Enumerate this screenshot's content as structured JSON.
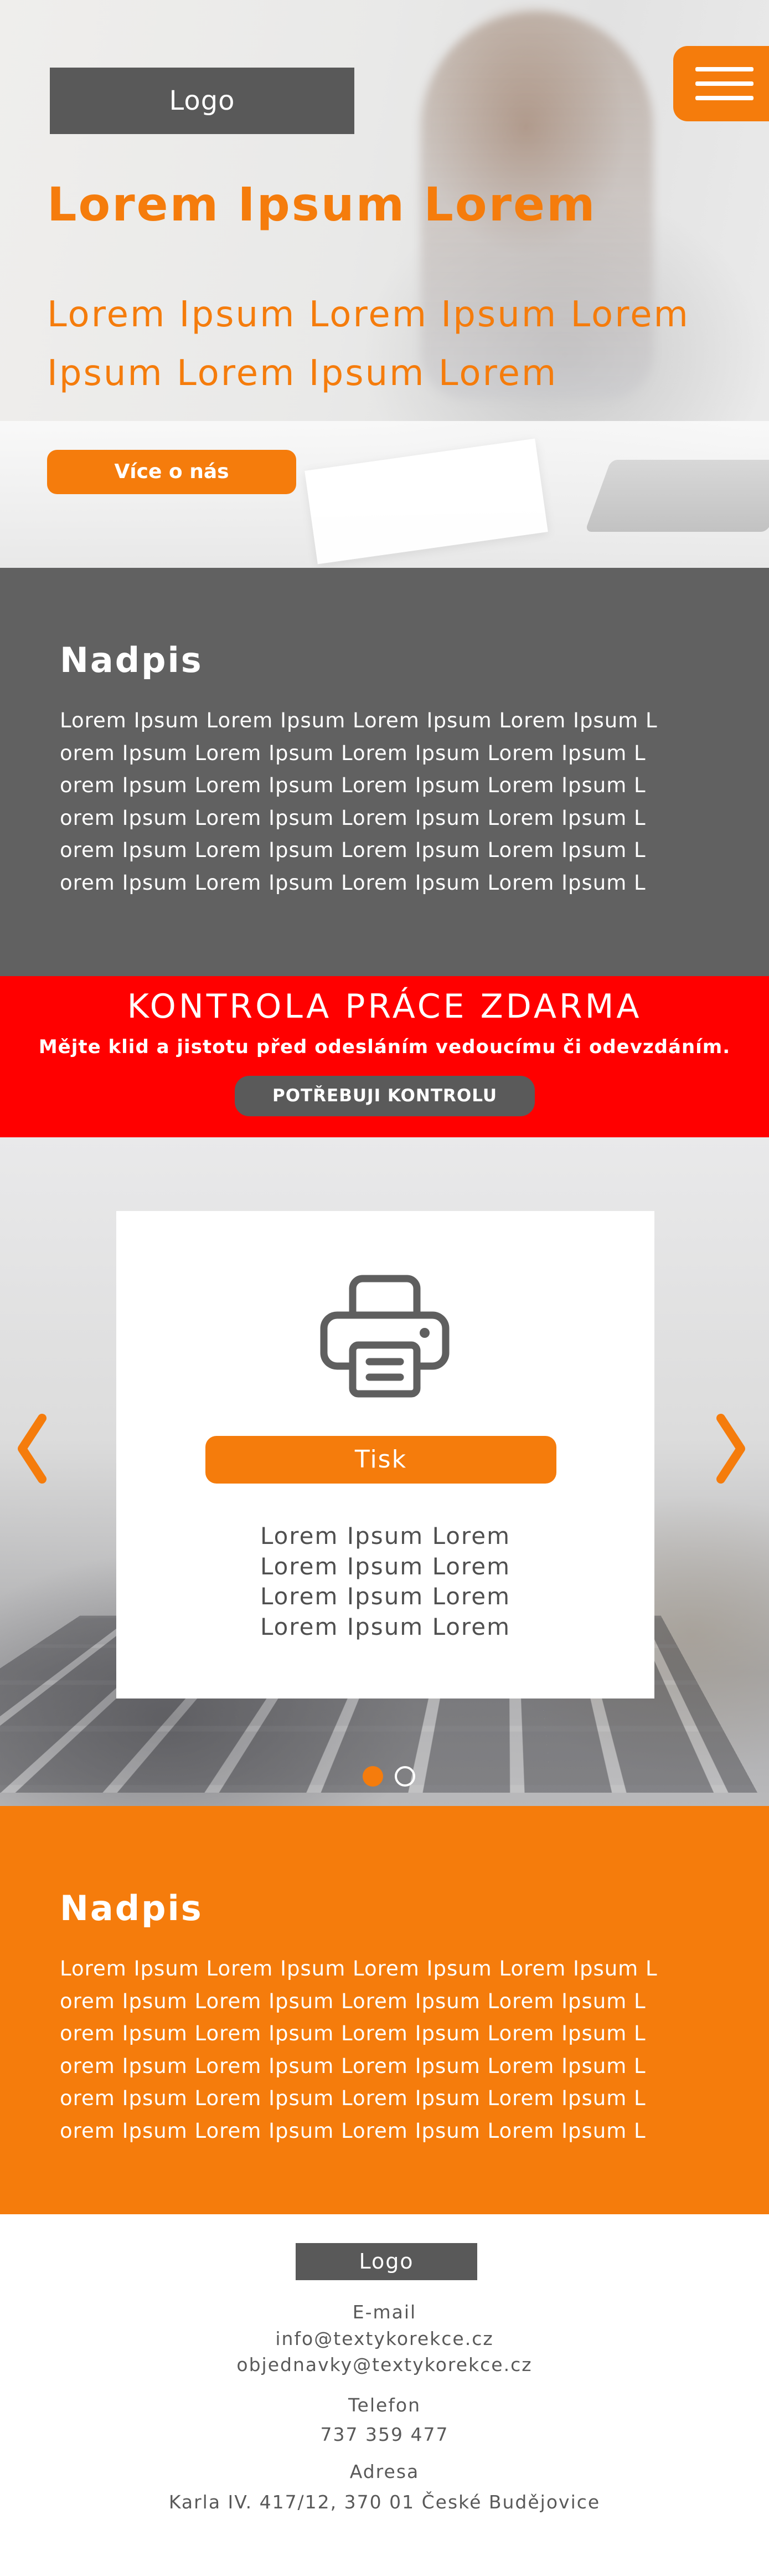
{
  "hero": {
    "logo": "Logo",
    "title": "Lorem Ipsum Lorem",
    "subtitle": "Lorem Ipsum Lorem Ipsum Lorem Ipsum Lorem Ipsum Lorem",
    "cta": "Více o nás"
  },
  "menu": {
    "icon": "hamburger-icon"
  },
  "about": {
    "heading": "Nadpis",
    "body": "Lorem Ipsum Lorem Ipsum Lorem Ipsum Lorem Ipsum Lorem Ipsum Lorem Ipsum Lorem Ipsum Lorem Ipsum Lorem Ipsum Lorem Ipsum Lorem Ipsum Lorem Ipsum Lorem Ipsum Lorem Ipsum Lorem Ipsum Lorem Ipsum Lorem Ipsum Lorem Ipsum Lorem Ipsum Lorem Ipsum Lorem Ipsum Lorem Ipsum Lorem Ipsum Lorem Ipsum Lorem Ipsum Lorem Ipsum Lorem Ipsum Lorem Ipsum Lorem Ipsum Lorem Ipsum Lorem Ipsum Lorem Ipsum Lorem Ipsum Lorem Ipsum Lorem Ipsum Lorem Ipsum Lorem Ipsum Lorem Ipsum Lorem Ipsum Lorem Ipsum Lorem"
  },
  "promo": {
    "title": "KONTROLA PRÁCE ZDARMA",
    "subtitle": "Mějte klid a jistotu před odesláním vedoucímu či odevzdáním.",
    "button": "POTŘEBUJI KONTROLU"
  },
  "slider": {
    "prev_icon": "chevron-left-icon",
    "next_icon": "chevron-right-icon",
    "slide": {
      "icon": "printer-icon",
      "button": "Tisk",
      "lines": [
        "Lorem Ipsum Lorem",
        "Lorem Ipsum Lorem",
        "Lorem Ipsum Lorem",
        "Lorem Ipsum Lorem"
      ]
    },
    "current_slide": 1,
    "total_slides": 2
  },
  "services": {
    "heading": "Nadpis",
    "body": "Lorem Ipsum Lorem Ipsum Lorem Ipsum Lorem Ipsum Lorem Ipsum Lorem Ipsum Lorem Ipsum Lorem Ipsum Lorem Ipsum Lorem Ipsum Lorem Ipsum Lorem Ipsum Lorem Ipsum Lorem Ipsum Lorem Ipsum Lorem Ipsum Lorem Ipsum Lorem Ipsum Lorem Ipsum Lorem Ipsum Lorem Ipsum Lorem Ipsum Lorem Ipsum Lorem Ipsum Lorem Ipsum Lorem Ipsum Lorem Ipsum Lorem Ipsum Lorem Ipsum Lorem Ipsum Lorem Ipsum Lorem Ipsum Lorem Ipsum Lorem Ipsum Lorem Ipsum Lorem Ipsum Lorem Ipsum Lorem Ipsum Lorem Ipsum Lorem Ipsum Lorem"
  },
  "footer": {
    "logo": "Logo",
    "email_label": "E-mail",
    "email_1": "info@textykorekce.cz",
    "email_2": "objednavky@textykorekce.cz",
    "phone_label": "Telefon",
    "phone": "737 359 477",
    "address_label": "Adresa",
    "address": "Karla IV. 417/12, 370 01 České Budějovice"
  },
  "colors": {
    "accent": "#f57c0c",
    "dark_grey": "#616161",
    "promo_red": "#ff0000"
  }
}
